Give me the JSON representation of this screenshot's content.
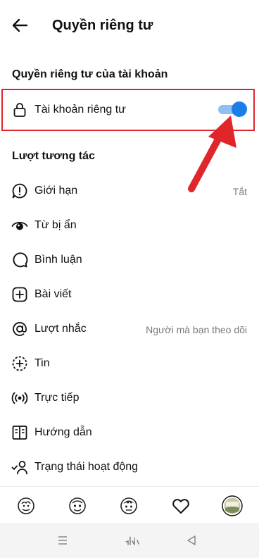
{
  "header": {
    "title": "Quyền riêng tư"
  },
  "account_section": {
    "heading": "Quyền riêng tư của tài khoản",
    "private_account": {
      "label": "Tài khoản riêng tư",
      "enabled": true
    }
  },
  "interactions_section": {
    "heading": "Lượt tương tác",
    "items": [
      {
        "label": "Giới hạn",
        "value": "Tắt",
        "icon": "limit-icon"
      },
      {
        "label": "Từ bị ẩn",
        "value": "",
        "icon": "hidden-eye-icon"
      },
      {
        "label": "Bình luận",
        "value": "",
        "icon": "comment-icon"
      },
      {
        "label": "Bài viết",
        "value": "",
        "icon": "post-plus-icon"
      },
      {
        "label": "Lượt nhắc",
        "value": "Người mà bạn theo dõi",
        "icon": "at-mention-icon"
      },
      {
        "label": "Tin",
        "value": "",
        "icon": "story-plus-icon"
      },
      {
        "label": "Trực tiếp",
        "value": "",
        "icon": "live-icon"
      },
      {
        "label": "Hướng dẫn",
        "value": "",
        "icon": "guide-book-icon"
      },
      {
        "label": "Trạng thái hoạt động",
        "value": "",
        "icon": "activity-status-icon"
      }
    ]
  },
  "bottom_nav": [
    "home-icon",
    "search-icon",
    "reels-icon",
    "activity-heart-icon",
    "profile-avatar-icon"
  ],
  "colors": {
    "accent": "#1b7ee8",
    "annotation": "#e0252b"
  }
}
